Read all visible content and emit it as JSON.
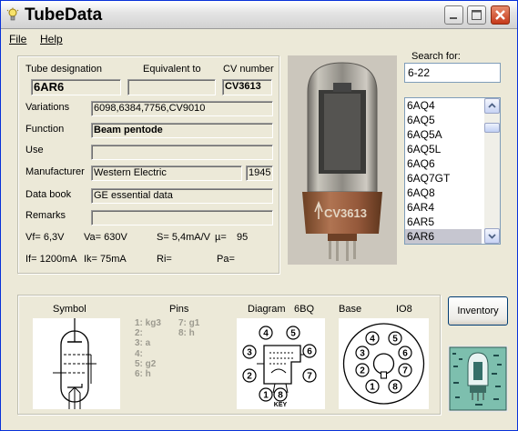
{
  "window": {
    "title": "TubeData"
  },
  "menu": {
    "file": "File",
    "help": "Help"
  },
  "labels": {
    "tube_designation": "Tube designation",
    "equivalent_to": "Equivalent to",
    "cv_number": "CV number",
    "variations": "Variations",
    "function": "Function",
    "use": "Use",
    "manufacturer": "Manufacturer",
    "data_book": "Data book",
    "remarks": "Remarks"
  },
  "fields": {
    "tube_designation": "6AR6",
    "equivalent_to": "",
    "cv_number": "CV3613",
    "variations": "6098,6384,7756,CV9010",
    "function": "Beam pentode",
    "use": "",
    "manufacturer": "Western Electric",
    "year": "1945",
    "data_book": "GE essential data",
    "remarks": ""
  },
  "params": {
    "vf": "Vf= 6,3V",
    "va": "Va= 630V",
    "s": "S= 5,4mA/V",
    "mu": "µ=",
    "mu_value": "95",
    "if": "If= 1200mA",
    "ik": "Ik= 75mA",
    "ri": "Ri=",
    "pa": "Pa="
  },
  "search": {
    "label": "Search for:",
    "value": "6-22"
  },
  "tube_list": {
    "items": [
      "6AQ4",
      "6AQ5",
      "6AQ5A",
      "6AQ5L",
      "6AQ6",
      "6AQ7GT",
      "6AQ8",
      "6AR4",
      "6AR5",
      "6AR6"
    ],
    "selected": "6AR6"
  },
  "photo": {
    "label_text": "CV3613"
  },
  "bottom": {
    "symbol_label": "Symbol",
    "pins_label": "Pins",
    "diagram_label": "Diagram",
    "diagram_code": "6BQ",
    "base_label": "Base",
    "base_code": "IO8",
    "pins_left": [
      "1: kg3",
      "2:",
      "3: a",
      "4:",
      "5: g2",
      "6: h"
    ],
    "pins_right": [
      "7: g1",
      "8: h"
    ],
    "diagram_pin_numbers": [
      "1",
      "2",
      "3",
      "4",
      "5",
      "6",
      "7",
      "8"
    ],
    "diagram_key": "KEY",
    "base_pin_numbers": [
      "1",
      "2",
      "3",
      "4",
      "5",
      "6",
      "7",
      "8"
    ]
  },
  "buttons": {
    "inventory": "Inventory"
  },
  "colors": {
    "title_close": "#c6391a",
    "window_bg": "#ece9d8",
    "selection": "#c6c6d0"
  }
}
